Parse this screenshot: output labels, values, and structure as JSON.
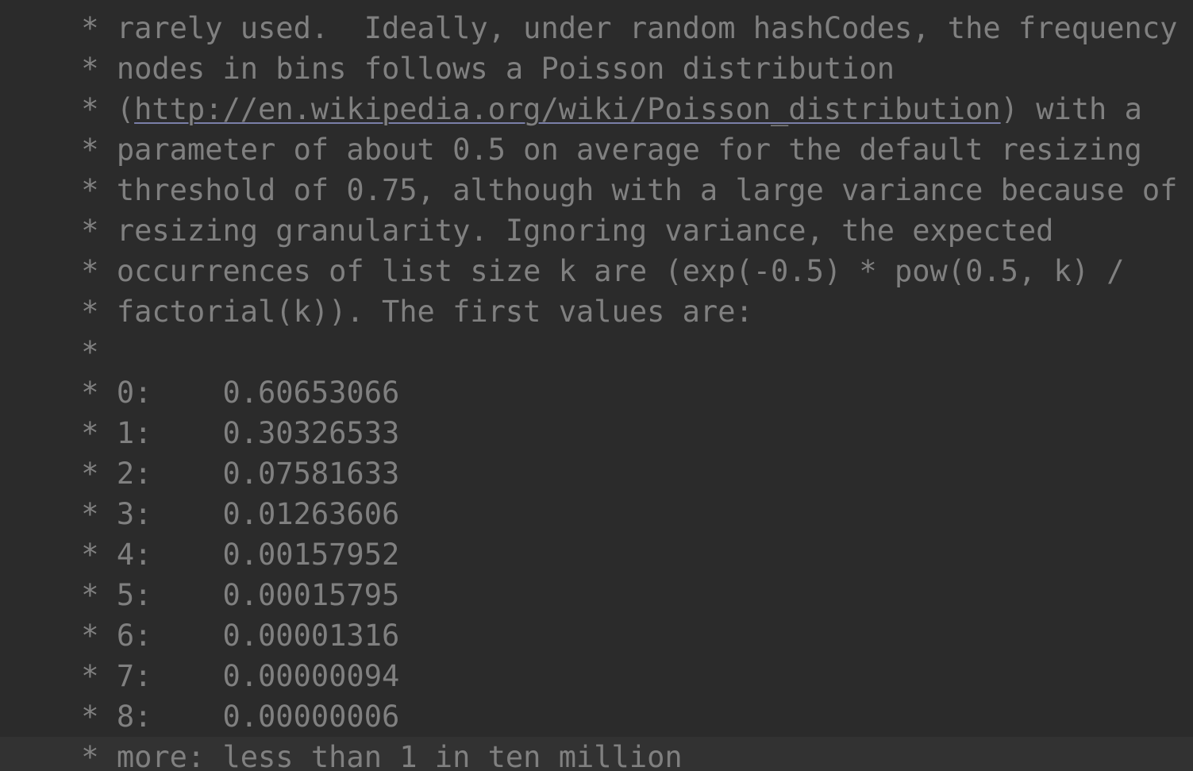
{
  "editor": {
    "theme_name": "darcula",
    "background_color": "#2b2b2b",
    "current_line_background": "#323232",
    "comment_color": "#808080",
    "link_underline_color": "#7a7fa8",
    "language": "java",
    "clipped_top_line": " "
  },
  "lines": [
    {
      "id": "line-rarely-used",
      "text": " * rarely used.  Ideally, under random hashCodes, the frequency of",
      "current": false
    },
    {
      "id": "line-nodes-in-bins",
      "text": " * nodes in bins follows a Poisson distribution",
      "current": false
    },
    {
      "id": "line-wiki-url",
      "text": " * (",
      "url": "http://en.wikipedia.org/wiki/Poisson_distribution",
      "suffix": ") with a",
      "current": false,
      "has_link": true
    },
    {
      "id": "line-parameter",
      "text": " * parameter of about 0.5 on average for the default resizing",
      "current": false
    },
    {
      "id": "line-threshold",
      "text": " * threshold of 0.75, although with a large variance because of",
      "current": false
    },
    {
      "id": "line-resizing",
      "text": " * resizing granularity. Ignoring variance, the expected",
      "current": false
    },
    {
      "id": "line-occurrences",
      "text": " * occurrences of list size k are (exp(-0.5) * pow(0.5, k) /",
      "current": false
    },
    {
      "id": "line-factorial",
      "text": " * factorial(k)). The first values are:",
      "current": false
    },
    {
      "id": "line-blank-star",
      "text": " *",
      "current": false
    },
    {
      "id": "line-value-0",
      "text": " * 0:    0.60653066",
      "current": false
    },
    {
      "id": "line-value-1",
      "text": " * 1:    0.30326533",
      "current": false
    },
    {
      "id": "line-value-2",
      "text": " * 2:    0.07581633",
      "current": false
    },
    {
      "id": "line-value-3",
      "text": " * 3:    0.01263606",
      "current": false
    },
    {
      "id": "line-value-4",
      "text": " * 4:    0.00157952",
      "current": false
    },
    {
      "id": "line-value-5",
      "text": " * 5:    0.00015795",
      "current": false
    },
    {
      "id": "line-value-6",
      "text": " * 6:    0.00001316",
      "current": false
    },
    {
      "id": "line-value-7",
      "text": " * 7:    0.00000094",
      "current": false
    },
    {
      "id": "line-value-8",
      "text": " * 8:    0.00000006",
      "current": false
    },
    {
      "id": "line-more",
      "text": " * more: less than 1 in ten million",
      "current": true
    }
  ],
  "poisson_table": {
    "caption": "The first values are:",
    "keys": [
      "0",
      "1",
      "2",
      "3",
      "4",
      "5",
      "6",
      "7",
      "8",
      "more"
    ],
    "values": [
      "0.60653066",
      "0.30326533",
      "0.07581633",
      "0.01263606",
      "0.00157952",
      "0.00015795",
      "0.00001316",
      "0.00000094",
      "0.00000006",
      "less than 1 in ten million"
    ]
  }
}
